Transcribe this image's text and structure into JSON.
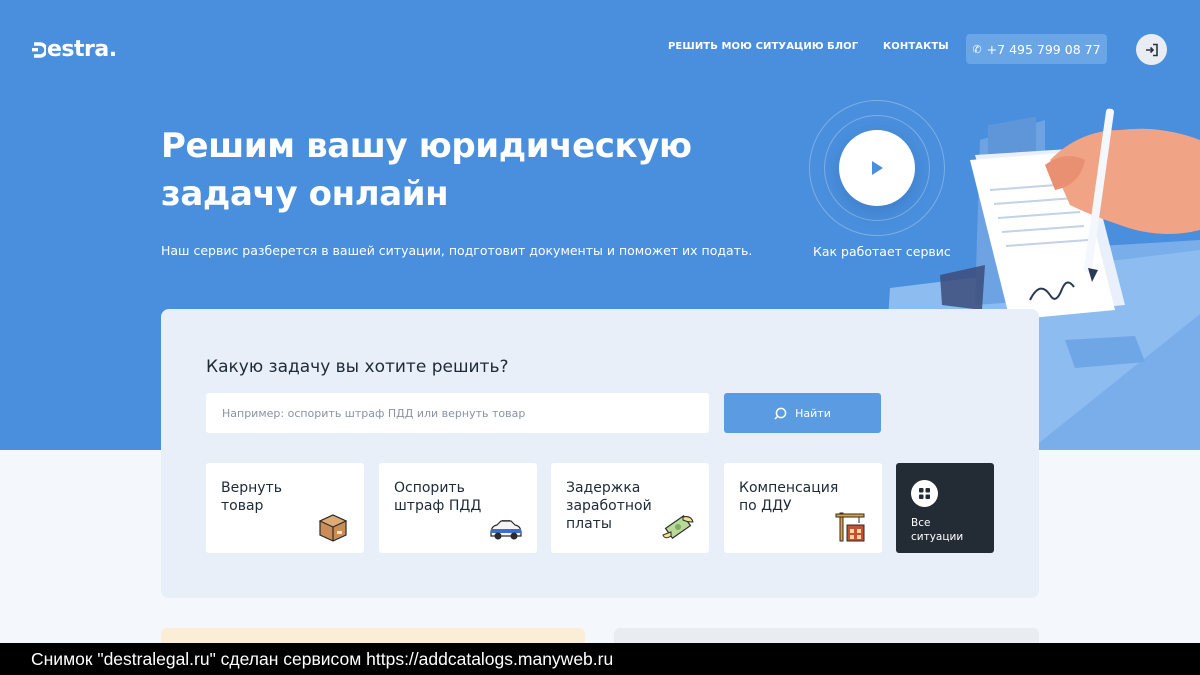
{
  "header": {
    "logo": "estra.",
    "nav": [
      "РЕШИТЬ МОЮ СИТУАЦИЮ",
      "БЛОГ",
      "КОНТАКТЫ"
    ],
    "phone": "+7 495 799 08 77"
  },
  "hero": {
    "title": "Решим вашу юридическую задачу онлайн",
    "subtitle": "Наш сервис разберется в вашей ситуации, подготовит документы и поможет их подать.",
    "video_label": "Как работает сервис"
  },
  "search": {
    "question": "Какую задачу вы хотите решить?",
    "placeholder": "Например: оспорить штраф ПДД или вернуть товар",
    "button": "Найти"
  },
  "tiles": [
    {
      "label": "Вернуть\nтовар",
      "icon": "package-icon"
    },
    {
      "label": "Оспорить\nштраф ПДД",
      "icon": "police-car-icon"
    },
    {
      "label": "Задержка\nзаработной\nплаты",
      "icon": "money-wings-icon"
    },
    {
      "label": "Компенсация\nпо ДДУ",
      "icon": "building-construction-icon"
    }
  ],
  "all_situations": {
    "label": "Все\nситуации",
    "icon": "grid-icon"
  },
  "caption": "Снимок \"destralegal.ru\" сделан сервисом https://addcatalogs.manyweb.ru",
  "colors": {
    "hero_bg": "#4a8fdd",
    "accent_button": "#5b9be2",
    "dark_tile": "#232b35"
  }
}
